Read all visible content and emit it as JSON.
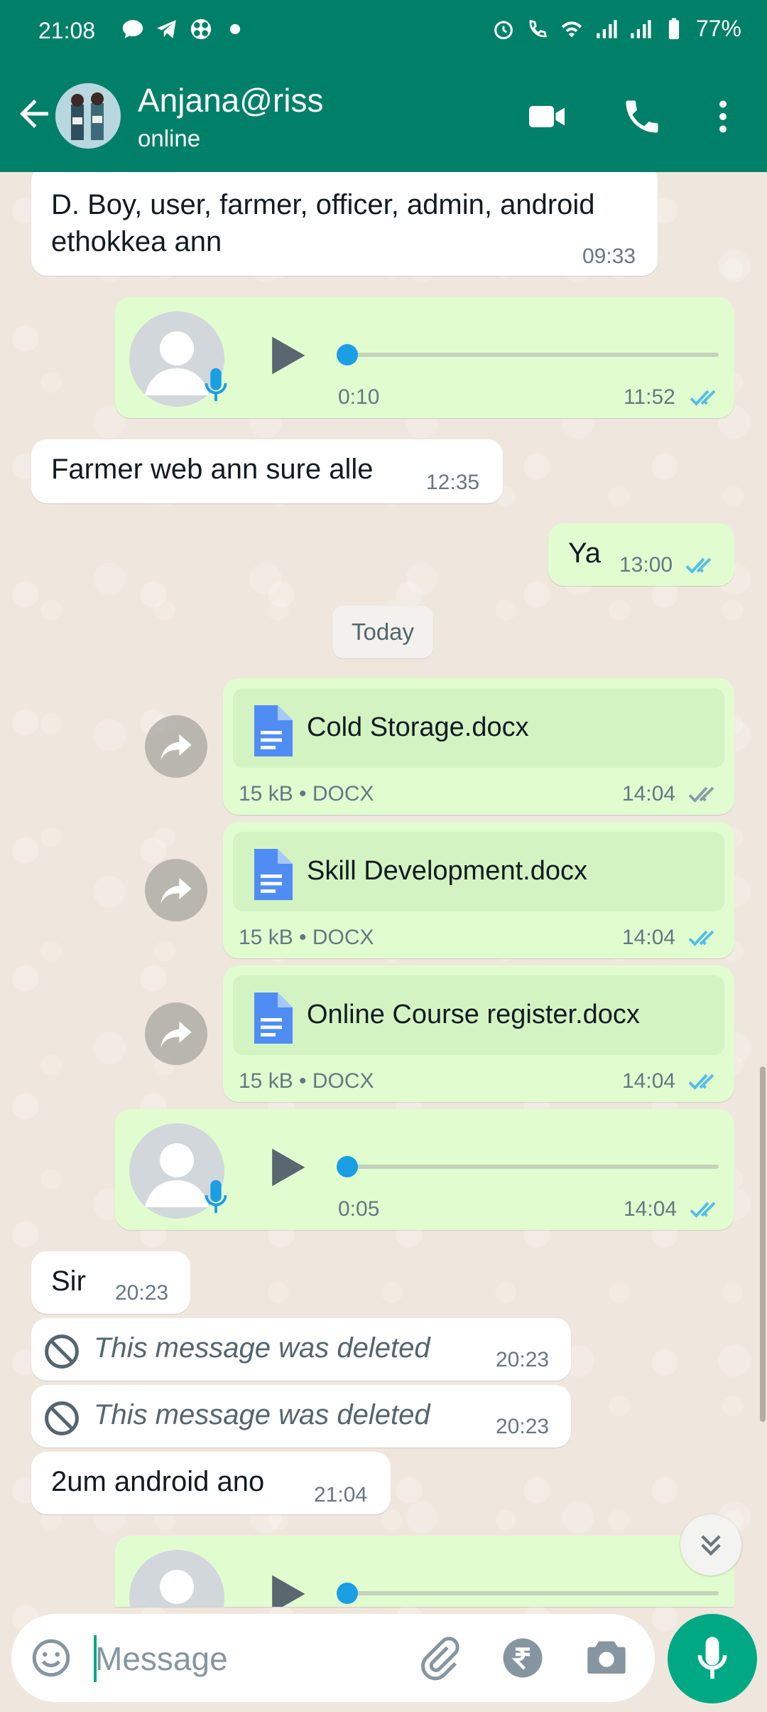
{
  "status_bar": {
    "time": "21:08",
    "battery": "77%"
  },
  "header": {
    "contact_name": "Anjana@riss",
    "presence": "online"
  },
  "messages": {
    "m1": {
      "text_line1": "D. Boy, user, farmer, officer, admin, android",
      "text_line2": "ethokkea ann",
      "time": "09:33"
    },
    "v1": {
      "duration": "0:10",
      "time": "11:52",
      "progress": 0.0
    },
    "m2": {
      "text": "Farmer web ann sure alle",
      "time": "12:35"
    },
    "m3": {
      "text": "Ya",
      "time": "13:00"
    },
    "date_divider": "Today",
    "doc1": {
      "name": "Cold Storage.docx",
      "meta": "15 kB • DOCX",
      "time": "14:04"
    },
    "doc2": {
      "name": "Skill Development.docx",
      "meta": "15 kB • DOCX",
      "time": "14:04"
    },
    "doc3": {
      "name": "Online Course register.docx",
      "meta": "15 kB • DOCX",
      "time": "14:04"
    },
    "v2": {
      "duration": "0:05",
      "time": "14:04",
      "progress": 0.0
    },
    "m4": {
      "text": "Sir",
      "time": "20:23"
    },
    "m5": {
      "text": "This message was deleted",
      "time": "20:23"
    },
    "m6": {
      "text": "This message was deleted",
      "time": "20:23"
    },
    "m7": {
      "text": "2um android ano",
      "time": "21:04"
    }
  },
  "composer": {
    "placeholder": "Message"
  },
  "colors": {
    "header": "#008069",
    "outgoing": "#e1fdd0",
    "incoming": "#ffffff",
    "read_ticks": "#53bdeb",
    "accent": "#00a884"
  },
  "icons": [
    "back-arrow-icon",
    "video-call-icon",
    "phone-icon",
    "more-options-icon",
    "emoji-icon",
    "attach-icon",
    "rupee-payment-icon",
    "camera-icon",
    "mic-icon",
    "forward-icon",
    "document-icon",
    "play-icon",
    "double-tick-icon",
    "blocked-icon",
    "chevron-double-down-icon"
  ]
}
